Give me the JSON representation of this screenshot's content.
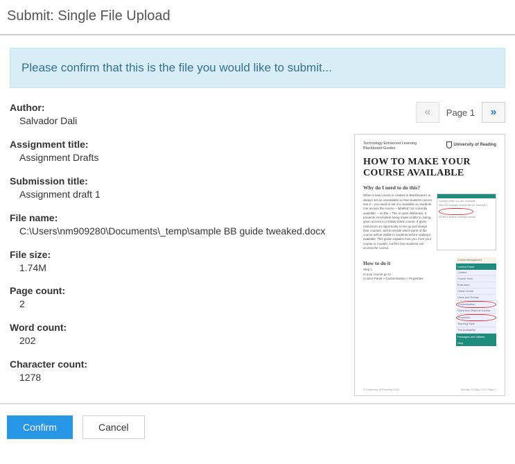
{
  "page_title": "Submit: Single File Upload",
  "alert_message": "Please confirm that this is the file you would like to submit...",
  "meta": {
    "author": {
      "label": "Author:",
      "value": "Salvador Dali"
    },
    "assignment_title": {
      "label": "Assignment title:",
      "value": "Assignment Drafts"
    },
    "submission_title": {
      "label": "Submission title:",
      "value": "Assignment draft 1"
    },
    "file_name": {
      "label": "File name:",
      "value": "C:\\Users\\nm909280\\Documents\\_temp\\sample BB guide tweaked.docx"
    },
    "file_size": {
      "label": "File size:",
      "value": "1.74M"
    },
    "page_count": {
      "label": "Page count:",
      "value": "2"
    },
    "word_count": {
      "label": "Word count:",
      "value": "202"
    },
    "character_count": {
      "label": "Character count:",
      "value": "1278"
    }
  },
  "pager": {
    "prev_glyph": "«",
    "label": "Page 1",
    "next_glyph": "»"
  },
  "preview": {
    "brand_line1": "Technology Enhanced Learning",
    "brand_line2": "Blackboard Guides",
    "logo_text": "University of Reading",
    "title": "HOW TO MAKE YOUR COURSE AVAILABLE",
    "why_heading": "Why do I need to do this?",
    "howto_heading": "How to do it",
    "step1": "Step 1",
    "step2": "In your course go to",
    "step3": "Control Panel > Customisation > Properties",
    "side_head": "Course Management",
    "side_sub": "Control Panel",
    "side_items": [
      "Content",
      "Course Tools",
      "Evaluation",
      "Grade Centre",
      "Users and Groups",
      "Customisation",
      "Guest and Observer Access",
      "Properties",
      "Teaching Style",
      "Tool Availability",
      "Packages and Utilities",
      "Help"
    ],
    "foot_left": "© University of Reading 2015",
    "foot_right": "Sunday 21 May 2017   Page 1"
  },
  "buttons": {
    "confirm": "Confirm",
    "cancel": "Cancel"
  }
}
